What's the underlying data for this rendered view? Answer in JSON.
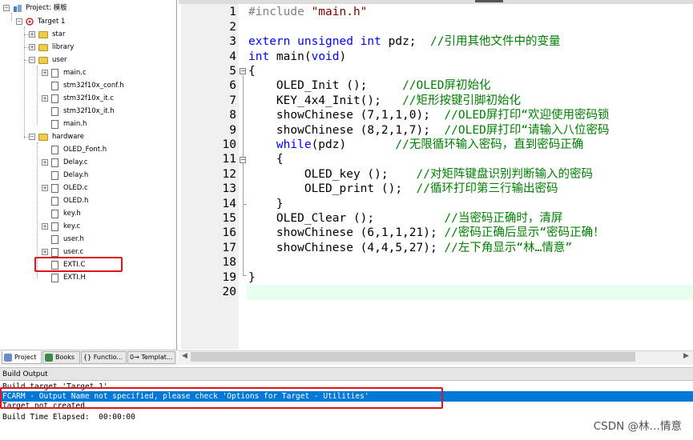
{
  "project": {
    "root_label": "Project: 模板",
    "target": "Target 1",
    "items": [
      {
        "label": "star"
      },
      {
        "label": "library"
      },
      {
        "label": "user"
      },
      {
        "label": "main.c"
      },
      {
        "label": "stm32f10x_conf.h"
      },
      {
        "label": "stm32f10x_it.c"
      },
      {
        "label": "stm32f10x_it.h"
      },
      {
        "label": "main.h"
      },
      {
        "label": "hardware"
      },
      {
        "label": "OLED_Font.h"
      },
      {
        "label": "Delay.c"
      },
      {
        "label": "Delay.h"
      },
      {
        "label": "OLED.c"
      },
      {
        "label": "OLED.h"
      },
      {
        "label": "key.h"
      },
      {
        "label": "key.c"
      },
      {
        "label": "user.h"
      },
      {
        "label": "user.c"
      },
      {
        "label": "EXTI.C"
      },
      {
        "label": "EXTI.H"
      }
    ]
  },
  "panel_tabs": [
    {
      "label": "Project"
    },
    {
      "label": "Books"
    },
    {
      "label": "{} Functio..."
    },
    {
      "label": "0→ Templat..."
    }
  ],
  "editor": {
    "line_numbers": [
      "1",
      "2",
      "3",
      "4",
      "5",
      "6",
      "7",
      "8",
      "9",
      "10",
      "11",
      "12",
      "13",
      "14",
      "15",
      "16",
      "17",
      "18",
      "19",
      "20"
    ],
    "lines": [
      {
        "pre": "#include ",
        "str": "\"main.h\""
      },
      {},
      {
        "kw": "extern unsigned int",
        "text": " pdz;  ",
        "cm": "//引用其他文件中的变量"
      },
      {
        "kw": "int",
        "text": " main(",
        "kw2": "void",
        "text2": ")"
      },
      {
        "text": "{"
      },
      {
        "text": "    OLED_Init ();     ",
        "cm": "//OLED屏初始化"
      },
      {
        "text": "    KEY_4x4_Init();   ",
        "cm": "//矩形按键引脚初始化"
      },
      {
        "text": "    showChinese (7,1,1,0);  ",
        "cm": "//OLED屏打印“欢迎使用密码锁"
      },
      {
        "text": "    showChinese (8,2,1,7);  ",
        "cm": "//OLED屏打印“请输入八位密码"
      },
      {
        "kw": "    while",
        "text": "(pdz)       ",
        "cm": "//无限循环输入密码，直到密码正确"
      },
      {
        "text": "    {"
      },
      {
        "text": "        OLED_key ();    ",
        "cm": "//对矩阵键盘识别判断输入的密码"
      },
      {
        "text": "        OLED_print ();  ",
        "cm": "//循环打印第三行输出密码"
      },
      {
        "text": "    }"
      },
      {
        "text": "    OLED_Clear ();          ",
        "cm": "//当密码正确时，清屏"
      },
      {
        "text": "    showChinese (6,1,1,21); ",
        "cm": "//密码正确后显示“密码正确！"
      },
      {
        "text": "    showChinese (4,4,5,27); ",
        "cm": "//左下角显示“林…情意”"
      },
      {},
      {
        "text": "}"
      },
      {}
    ]
  },
  "build_output": {
    "title": "Build Output",
    "lines": [
      "Build target 'Target 1'",
      "FCARM - Output Name not specified, please check 'Options for Target - Utilities'",
      "Target not created",
      "Build Time Elapsed:  00:00:00"
    ]
  },
  "watermark": "CSDN @林…情意",
  "colors": {
    "highlight": "#0078d7",
    "annotation_box": "#e0141e",
    "keyword": "#0000ff",
    "comment": "#008000",
    "string": "#800000"
  }
}
